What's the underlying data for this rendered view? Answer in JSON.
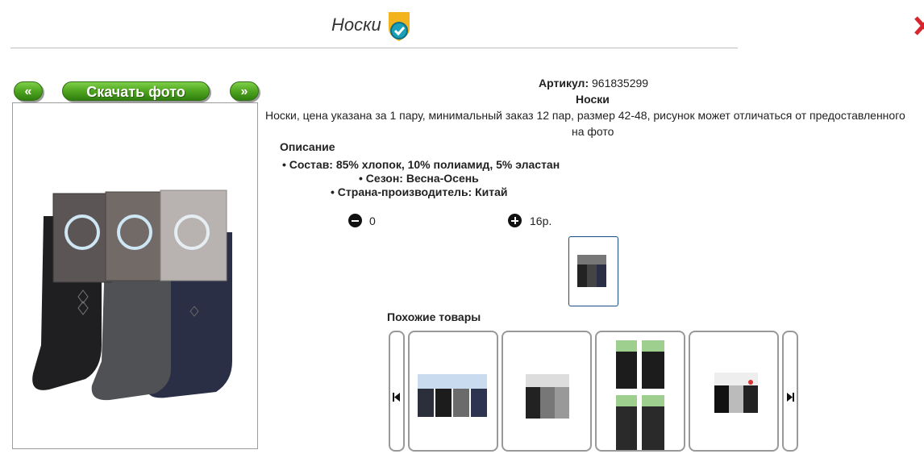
{
  "header": {
    "title": "Носки"
  },
  "gallery": {
    "prev_label": "«",
    "download_label": "Скачать фото",
    "next_label": "»"
  },
  "product": {
    "article_label": "Артикул:",
    "article_value": "961835299",
    "name": "Носки",
    "description_line1": "Носки, цена указана за 1 пару, минимальный заказ 12 пар, размер 42-48, рисунок может отличаться от предоставленного",
    "description_line2": "на фото",
    "description_heading": "Описание",
    "specs": [
      "Состав: 85% хлопок, 10% полиамид, 5% эластан",
      "Сезон: Весна-Осень",
      "Страна-производитель: Китай"
    ],
    "quantity": "0",
    "price": "16р."
  },
  "similar": {
    "title": "Похожие товары"
  },
  "colors": {
    "accent_green": "#4fa51f",
    "thumb_border": "#1a4a8a"
  }
}
